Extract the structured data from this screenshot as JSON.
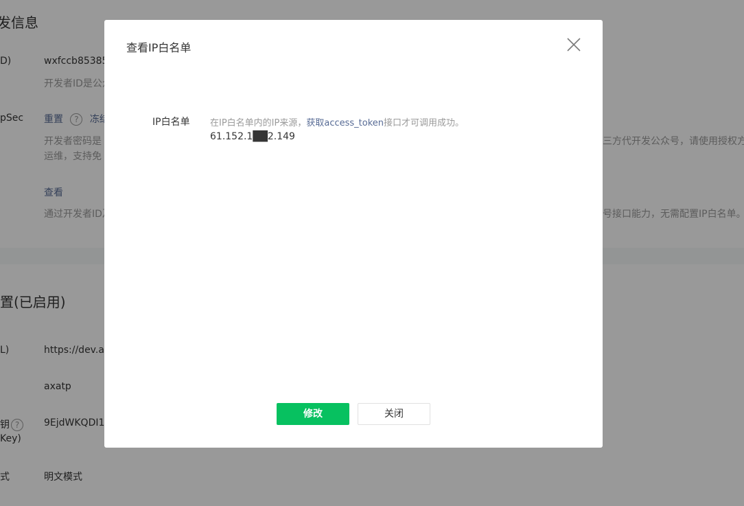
{
  "background": {
    "section1_title": "发信息",
    "appid_label": "D)",
    "appid_value": "wxfccb85385",
    "appid_desc": "开发者ID是公众",
    "secret_label": "pSec",
    "secret_reset": "重置",
    "secret_freeze": "冻结",
    "secret_desc_line1": "开发者密码是",
    "secret_desc_line1_right": "三方代开发公众号，请使用授权方",
    "secret_desc_line2": "运维，支持免",
    "view_link": "查看",
    "view_desc": "通过开发者ID及",
    "view_desc_right": "号接口能力，无需配置IP白名单。",
    "section2_title": "置(已启用)",
    "url_label": "L)",
    "url_value": "https://dev.al",
    "token_value": "axatp",
    "aeskey_label_1": "钥",
    "aeskey_label_2": "Key)",
    "aeskey_value": "9EjdWKQDI1",
    "mode_label": "式",
    "mode_value": "明文模式"
  },
  "dialog": {
    "title": "查看IP白名单",
    "whitelist_label": "IP白名单",
    "hint_prefix": "在IP白名单内的IP来源，",
    "hint_link": "获取access_token",
    "hint_suffix": "接口才可调用成功。",
    "ip_value": "61.152.1██2.149",
    "confirm_label": "修改",
    "close_label": "关闭"
  },
  "colors": {
    "primary": "#07c160",
    "link": "#576b95",
    "mask": "rgba(0,0,0,0.40)"
  }
}
